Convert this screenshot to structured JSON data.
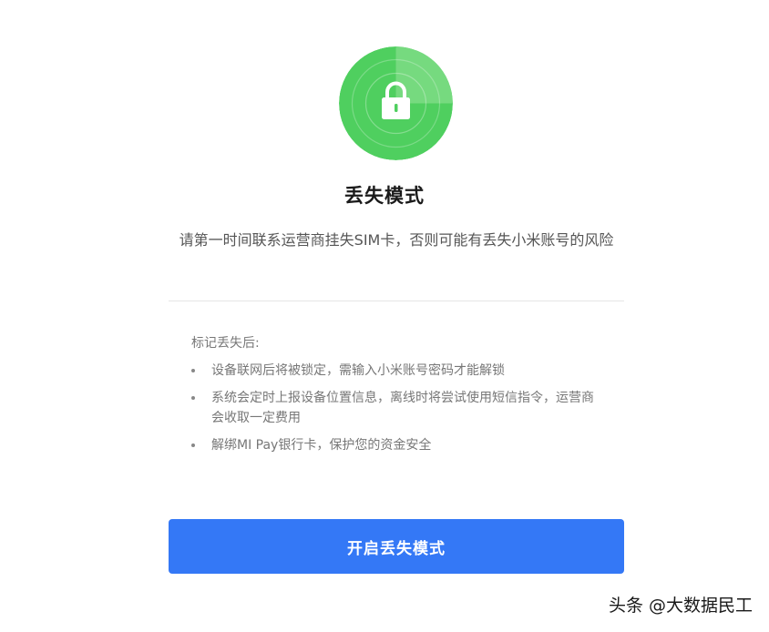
{
  "hero": {
    "icon": "lock-icon",
    "accent_color": "#4fcf5f",
    "title": "丢失模式",
    "description": "请第一时间联系运营商挂失SIM卡，否则可能有丢失小米账号的风险"
  },
  "info": {
    "heading": "标记丢失后:",
    "items": [
      "设备联网后将被锁定，需输入小米账号密码才能解锁",
      "系统会定时上报设备位置信息，离线时将尝试使用短信指令，运营商会收取一定费用",
      "解绑MI Pay银行卡，保护您的资金安全"
    ]
  },
  "action": {
    "label": "开启丢失模式",
    "color": "#3478f6"
  },
  "watermark": {
    "text": "头条 @大数据民工"
  }
}
